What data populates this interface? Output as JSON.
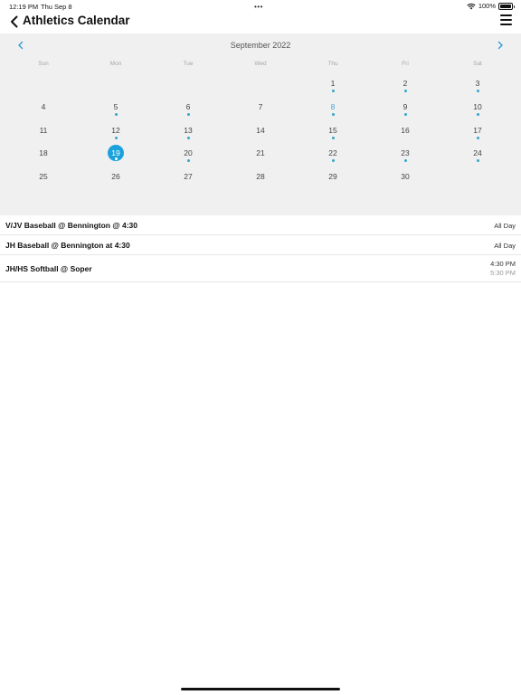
{
  "status_bar": {
    "time": "12:19 PM",
    "date": "Thu Sep 8",
    "multitask_dots": "•••",
    "battery": "100%"
  },
  "nav": {
    "title": "Athletics Calendar",
    "back_icon": "chevron-left-icon",
    "menu_icon": "hamburger-menu-icon"
  },
  "calendar": {
    "month_label": "September 2022",
    "prev_icon": "chevron-left-icon",
    "next_icon": "chevron-right-icon",
    "weekdays": [
      "Sun",
      "Mon",
      "Tue",
      "Wed",
      "Thu",
      "Fri",
      "Sat"
    ],
    "today": "8",
    "selected": "19",
    "days": [
      {
        "n": "",
        "dot": false
      },
      {
        "n": "",
        "dot": false
      },
      {
        "n": "",
        "dot": false
      },
      {
        "n": "",
        "dot": false
      },
      {
        "n": "1",
        "dot": true
      },
      {
        "n": "2",
        "dot": true
      },
      {
        "n": "3",
        "dot": true
      },
      {
        "n": "4",
        "dot": false
      },
      {
        "n": "5",
        "dot": true
      },
      {
        "n": "6",
        "dot": true
      },
      {
        "n": "7",
        "dot": false
      },
      {
        "n": "8",
        "dot": true
      },
      {
        "n": "9",
        "dot": true
      },
      {
        "n": "10",
        "dot": true
      },
      {
        "n": "11",
        "dot": false
      },
      {
        "n": "12",
        "dot": true
      },
      {
        "n": "13",
        "dot": true
      },
      {
        "n": "14",
        "dot": false
      },
      {
        "n": "15",
        "dot": true
      },
      {
        "n": "16",
        "dot": false
      },
      {
        "n": "17",
        "dot": true
      },
      {
        "n": "18",
        "dot": false
      },
      {
        "n": "19",
        "dot": true
      },
      {
        "n": "20",
        "dot": true
      },
      {
        "n": "21",
        "dot": false
      },
      {
        "n": "22",
        "dot": true
      },
      {
        "n": "23",
        "dot": true
      },
      {
        "n": "24",
        "dot": true
      },
      {
        "n": "25",
        "dot": false
      },
      {
        "n": "26",
        "dot": false
      },
      {
        "n": "27",
        "dot": false
      },
      {
        "n": "28",
        "dot": false
      },
      {
        "n": "29",
        "dot": false
      },
      {
        "n": "30",
        "dot": false
      },
      {
        "n": "",
        "dot": false
      }
    ],
    "accent_color": "#1ba2dc"
  },
  "events": [
    {
      "title": "V/JV Baseball @ Bennington @ 4:30",
      "time": "All Day"
    },
    {
      "title": "JH Baseball @ Bennington at 4:30",
      "time": "All Day"
    },
    {
      "title": "JH/HS Softball @ Soper",
      "start": "4:30 PM",
      "end": "5:30 PM"
    }
  ]
}
